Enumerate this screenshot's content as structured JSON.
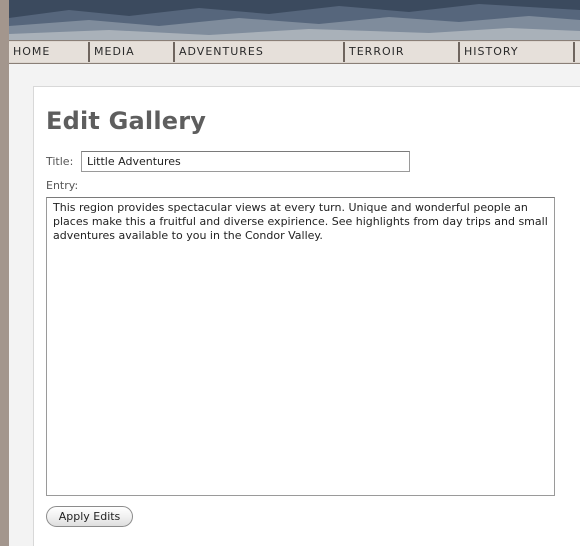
{
  "nav": {
    "items": [
      {
        "label": "HOME"
      },
      {
        "label": "MEDIA"
      },
      {
        "label": "ADVENTURES"
      },
      {
        "label": "TERROIR"
      },
      {
        "label": "HISTORY"
      },
      {
        "label": ""
      }
    ]
  },
  "page": {
    "title": "Edit Gallery"
  },
  "form": {
    "title_label": "Title:",
    "title_value": "Little Adventures",
    "entry_label": "Entry:",
    "entry_value": "This region provides spectacular views at every turn. Unique and wonderful people an places make this a fruitful and diverse expirience. See highlights from day trips and small adventures available to you in the Condor Valley.",
    "submit_label": "Apply Edits"
  }
}
